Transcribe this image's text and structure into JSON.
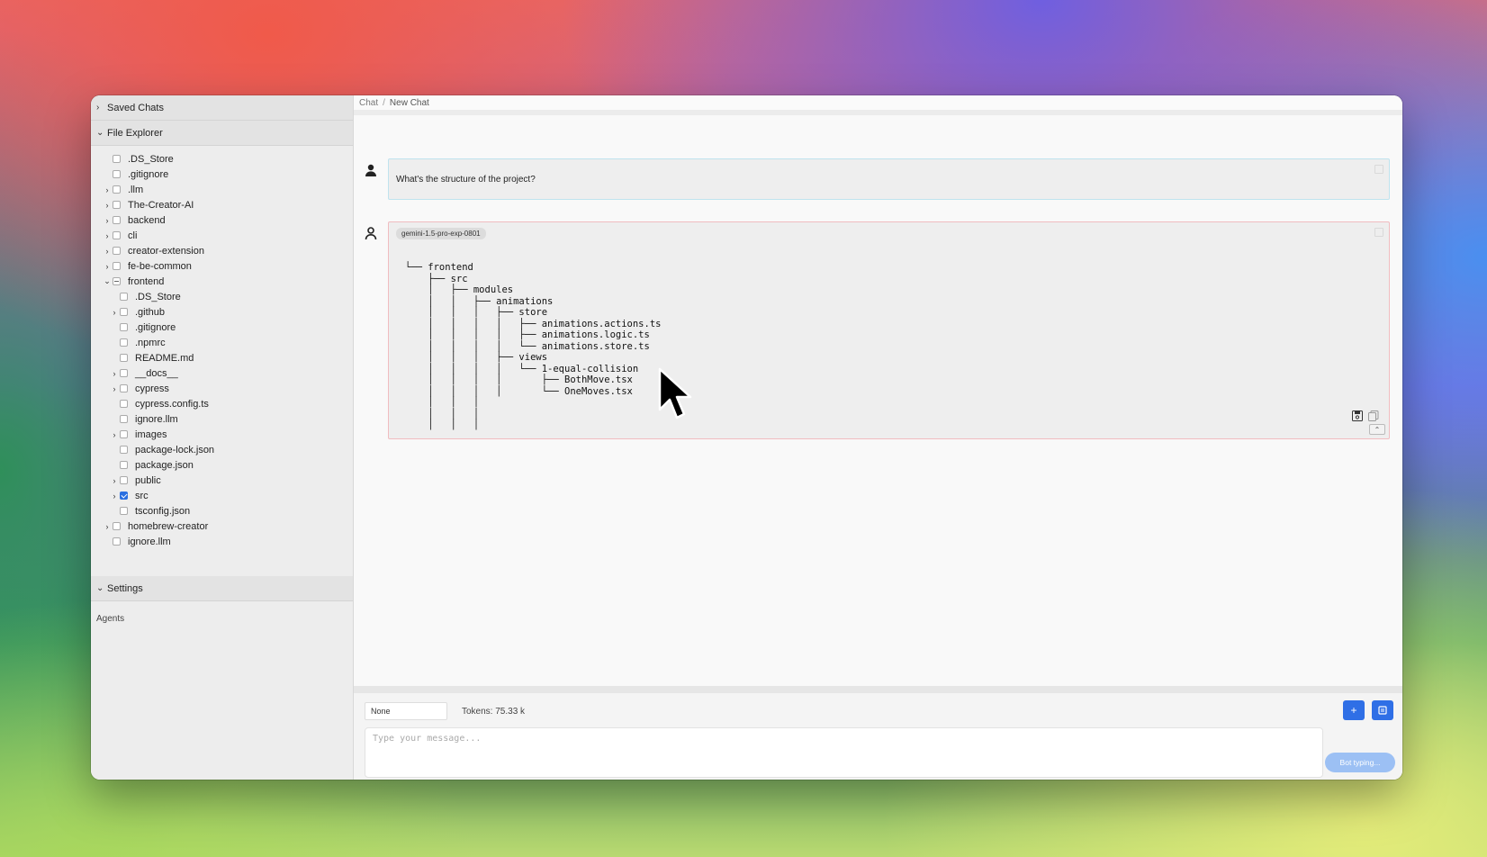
{
  "sidebar": {
    "saved_chats": "Saved Chats",
    "file_explorer": "File Explorer",
    "settings": "Settings",
    "agents": "Agents",
    "files": [
      {
        "name": ".DS_Store",
        "depth": 0,
        "caret": "",
        "state": "empty"
      },
      {
        "name": ".gitignore",
        "depth": 0,
        "caret": "",
        "state": "empty"
      },
      {
        "name": ".llm",
        "depth": 0,
        "caret": "›",
        "state": "empty"
      },
      {
        "name": "The-Creator-AI",
        "depth": 0,
        "caret": "›",
        "state": "empty"
      },
      {
        "name": "backend",
        "depth": 0,
        "caret": "›",
        "state": "empty"
      },
      {
        "name": "cli",
        "depth": 0,
        "caret": "›",
        "state": "empty"
      },
      {
        "name": "creator-extension",
        "depth": 0,
        "caret": "›",
        "state": "empty"
      },
      {
        "name": "fe-be-common",
        "depth": 0,
        "caret": "›",
        "state": "empty"
      },
      {
        "name": "frontend",
        "depth": 0,
        "caret": "⌄",
        "state": "partial"
      },
      {
        "name": ".DS_Store",
        "depth": 1,
        "caret": "",
        "state": "empty"
      },
      {
        "name": ".github",
        "depth": 1,
        "caret": "›",
        "state": "empty"
      },
      {
        "name": ".gitignore",
        "depth": 1,
        "caret": "",
        "state": "empty"
      },
      {
        "name": ".npmrc",
        "depth": 1,
        "caret": "",
        "state": "empty"
      },
      {
        "name": "README.md",
        "depth": 1,
        "caret": "",
        "state": "empty"
      },
      {
        "name": "__docs__",
        "depth": 1,
        "caret": "›",
        "state": "empty"
      },
      {
        "name": "cypress",
        "depth": 1,
        "caret": "›",
        "state": "empty"
      },
      {
        "name": "cypress.config.ts",
        "depth": 1,
        "caret": "",
        "state": "empty"
      },
      {
        "name": "ignore.llm",
        "depth": 1,
        "caret": "",
        "state": "empty"
      },
      {
        "name": "images",
        "depth": 1,
        "caret": "›",
        "state": "empty"
      },
      {
        "name": "package-lock.json",
        "depth": 1,
        "caret": "",
        "state": "empty"
      },
      {
        "name": "package.json",
        "depth": 1,
        "caret": "",
        "state": "empty"
      },
      {
        "name": "public",
        "depth": 1,
        "caret": "›",
        "state": "empty"
      },
      {
        "name": "src",
        "depth": 1,
        "caret": "›",
        "state": "checked"
      },
      {
        "name": "tsconfig.json",
        "depth": 1,
        "caret": "",
        "state": "empty"
      },
      {
        "name": "homebrew-creator",
        "depth": 0,
        "caret": "›",
        "state": "empty"
      },
      {
        "name": "ignore.llm",
        "depth": 0,
        "caret": "",
        "state": "empty"
      }
    ]
  },
  "breadcrumb": {
    "root": "Chat",
    "sep": "/",
    "current": "New Chat"
  },
  "messages": {
    "user_text": "What's the structure of the project?",
    "bot_model": "gemini-1.5-pro-exp-0801",
    "bot_tree": "└── frontend\n    ├── src\n    │   ├── modules\n    │   │   ├── animations\n    │   │   │   ├── store\n    │   │   │   │   ├── animations.actions.ts\n    │   │   │   │   ├── animations.logic.ts\n    │   │   │   │   └── animations.store.ts\n    │   │   │   ├── views\n    │   │   │   │   └── 1-equal-collision\n    │   │   │   │       ├── BothMove.tsx\n    │   │   │   │       └── OneMoves.tsx\n    │   │   │\n    │   │   │\n    │   │   │"
  },
  "composer": {
    "select_value": "None",
    "tokens": "Tokens: 75.33 k",
    "plus_label": "+",
    "placeholder": "Type your message...",
    "bot_typing": "Bot typing..."
  },
  "colors": {
    "accent": "#2f6fe6",
    "bot_border": "#f0bcc0",
    "user_border": "#bfe3ee"
  }
}
